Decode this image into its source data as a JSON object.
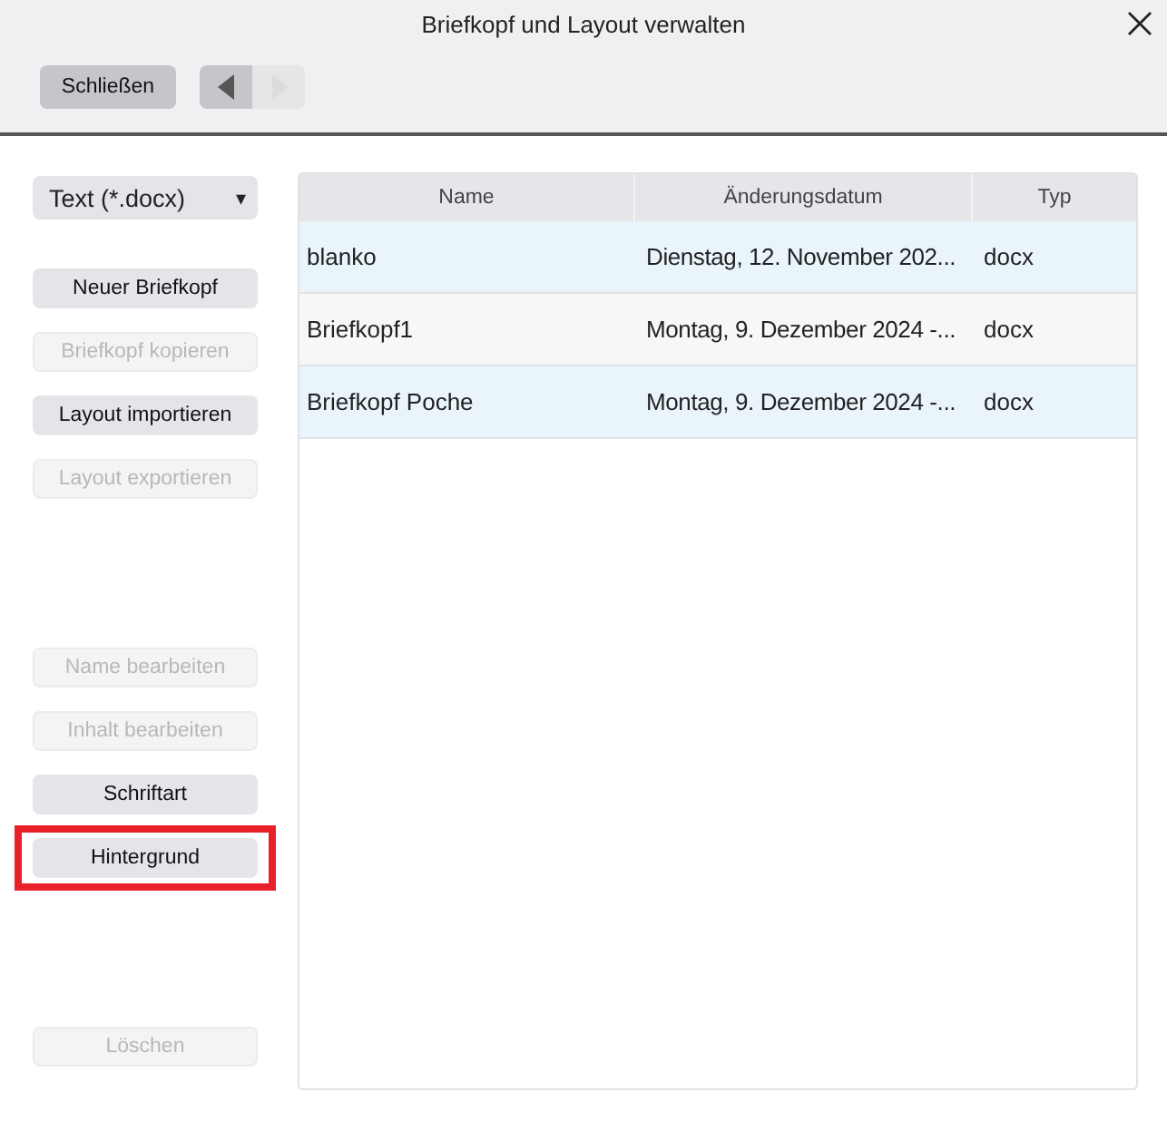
{
  "window": {
    "title": "Briefkopf und Layout verwalten"
  },
  "toolbar": {
    "close_label": "Schließen",
    "back_disabled": false,
    "forward_disabled": true
  },
  "format_select": {
    "value": "Text (*.docx)",
    "caret": "▾"
  },
  "button_groups": [
    [
      {
        "label": "Neuer Briefkopf",
        "disabled": false,
        "highlighted": false
      },
      {
        "label": "Briefkopf kopieren",
        "disabled": true,
        "highlighted": false
      },
      {
        "label": "Layout importieren",
        "disabled": false,
        "highlighted": false
      },
      {
        "label": "Layout exportieren",
        "disabled": true,
        "highlighted": false
      }
    ],
    [
      {
        "label": "Name bearbeiten",
        "disabled": true,
        "highlighted": false
      },
      {
        "label": "Inhalt bearbeiten",
        "disabled": true,
        "highlighted": false
      },
      {
        "label": "Schriftart",
        "disabled": false,
        "highlighted": false
      },
      {
        "label": "Hintergrund",
        "disabled": false,
        "highlighted": true
      }
    ],
    [
      {
        "label": "Löschen",
        "disabled": true,
        "highlighted": false
      }
    ]
  ],
  "table": {
    "columns": [
      "Name",
      "Änderungsdatum",
      "Typ"
    ],
    "rows": [
      [
        "blanko",
        "Dienstag, 12. November 202...",
        "docx"
      ],
      [
        "Briefkopf1",
        "Montag, 9. Dezember 2024 -...",
        "docx"
      ],
      [
        "Briefkopf Poche",
        "Montag, 9. Dezember 2024 -...",
        "docx"
      ]
    ]
  }
}
